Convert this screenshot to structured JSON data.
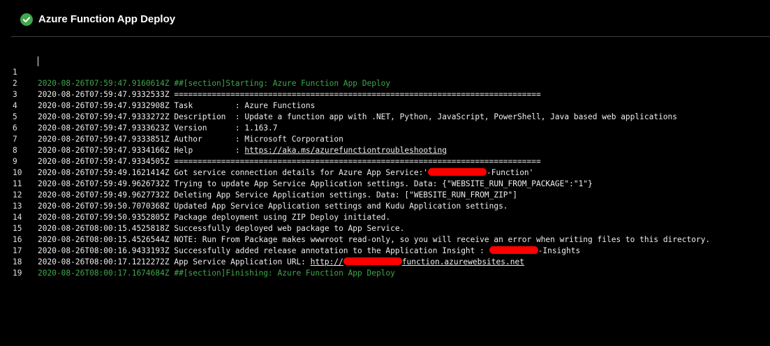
{
  "header": {
    "title": "Azure Function App Deploy",
    "status_icon": "check-circle-icon",
    "status_color": "#3ea84a"
  },
  "log": {
    "lines": [
      {
        "num": "1",
        "text": "2020-08-26T07:59:47.9160614Z ##[section]Starting: Azure Function App Deploy"
      },
      {
        "num": "2",
        "text": "2020-08-26T07:59:47.9332533Z =============================================================================="
      },
      {
        "num": "3",
        "text": "2020-08-26T07:59:47.9332908Z Task         : Azure Functions"
      },
      {
        "num": "4",
        "text": "2020-08-26T07:59:47.9333272Z Description  : Update a function app with .NET, Python, JavaScript, PowerShell, Java based web applications"
      },
      {
        "num": "5",
        "text": "2020-08-26T07:59:47.9333623Z Version      : 1.163.7"
      },
      {
        "num": "6",
        "text": "2020-08-26T07:59:47.9333851Z Author       : Microsoft Corporation"
      },
      {
        "num": "7",
        "text": "2020-08-26T07:59:47.9334166Z Help         : ",
        "link": "https://aka.ms/azurefunctiontroubleshooting"
      },
      {
        "num": "8",
        "text": "2020-08-26T07:59:47.9334505Z =============================================================================="
      },
      {
        "num": "9",
        "text": "2020-08-26T07:59:49.1621414Z Got service connection details for Azure App Service:'",
        "after": "-Function'"
      },
      {
        "num": "10",
        "text": "2020-08-26T07:59:49.9626732Z Trying to update App Service Application settings. Data: {\"WEBSITE_RUN_FROM_PACKAGE\":\"1\"}"
      },
      {
        "num": "11",
        "text": "2020-08-26T07:59:49.9627732Z Deleting App Service Application settings. Data: [\"WEBSITE_RUN_FROM_ZIP\"]"
      },
      {
        "num": "12",
        "text": "2020-08-26T07:59:50.7070368Z Updated App Service Application settings and Kudu Application settings."
      },
      {
        "num": "13",
        "text": "2020-08-26T07:59:50.9352805Z Package deployment using ZIP Deploy initiated."
      },
      {
        "num": "14",
        "text": "2020-08-26T08:00:15.4525818Z Successfully deployed web package to App Service."
      },
      {
        "num": "15",
        "text": "2020-08-26T08:00:15.4526544Z NOTE: Run From Package makes wwwroot read-only, so you will receive an error when writing files to this directory."
      },
      {
        "num": "16",
        "text": "2020-08-26T08:00:16.9433193Z Successfully added release annotation to the Application Insight : ",
        "after": "-Insights"
      },
      {
        "num": "17",
        "text": "2020-08-26T08:00:17.1212272Z App Service Application URL: ",
        "link_prefix": "http://",
        "link_suffix": "function.azurewebsites.net"
      },
      {
        "num": "18",
        "text": "2020-08-26T08:00:17.1674684Z ##[section]Finishing: Azure Function App Deploy"
      },
      {
        "num": "19",
        "text": ""
      }
    ]
  }
}
